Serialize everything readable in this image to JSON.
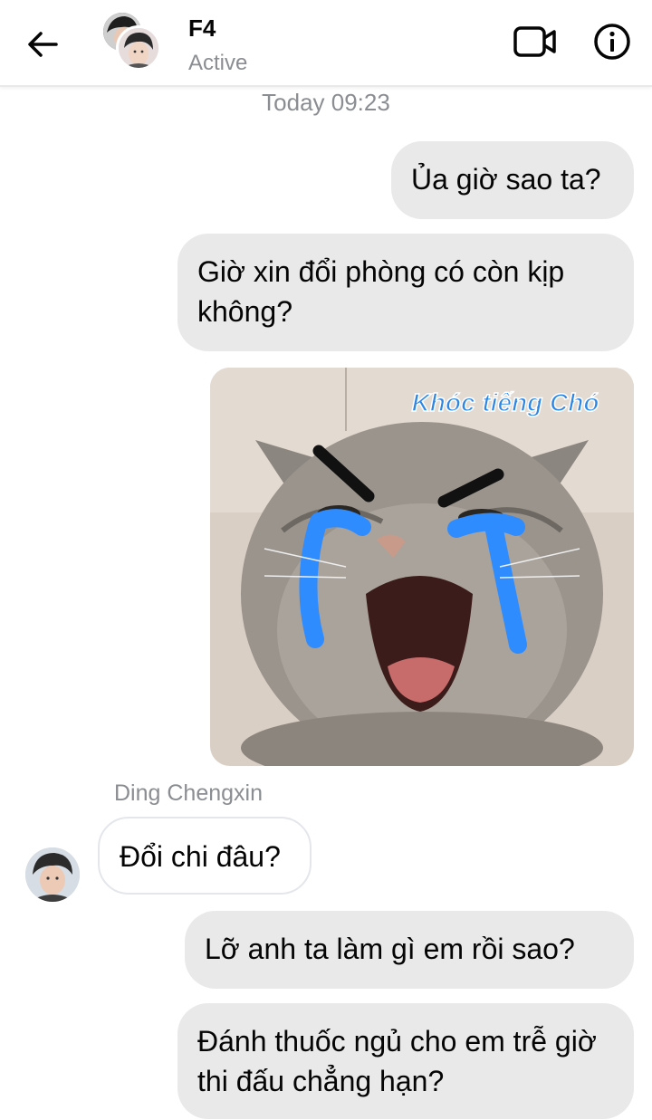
{
  "header": {
    "title": "F4",
    "status": "Active"
  },
  "timestamp": "Today 09:23",
  "messages": [
    {
      "text": "Ủa giờ sao ta?"
    },
    {
      "text": "Giờ xin đổi phòng có còn kịp không?"
    },
    {
      "sticker_caption": "Khóc tiếng Chó"
    },
    {
      "sender": "Ding Chengxin",
      "text": "Đổi chi đâu?"
    },
    {
      "text": "Lỡ anh ta làm gì em rồi sao?"
    },
    {
      "text": "Đánh thuốc ngủ cho em trễ giờ thi đấu chẳng hạn?"
    }
  ],
  "icons": {
    "back": "arrow-left-icon",
    "video": "video-camera-icon",
    "info": "info-icon"
  },
  "colors": {
    "bubble": "#e9e9e9",
    "incoming_bubble": "#ffffff",
    "muted_text": "#8a8d91",
    "tears": "#2f8cff"
  }
}
